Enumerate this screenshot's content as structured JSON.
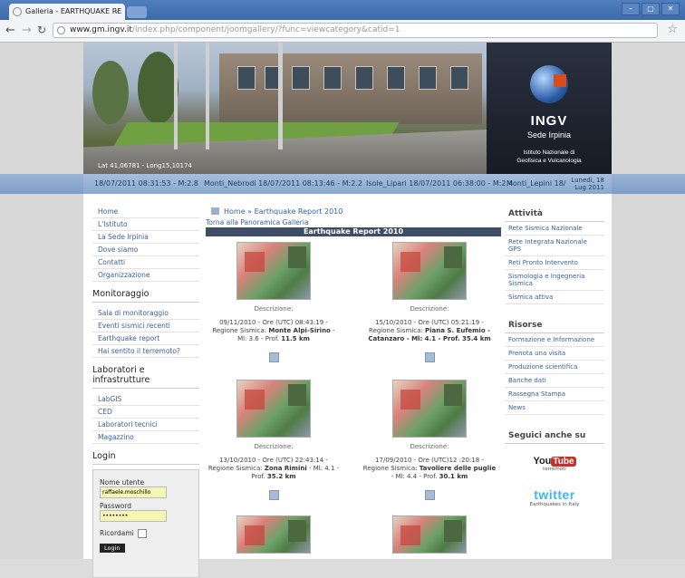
{
  "browser": {
    "tab_title": "Galleria - EARTHQUAKE RE",
    "tab_close": "×",
    "window_controls": [
      "–",
      "▢",
      "✕"
    ],
    "url_host": "www.gm.ingv.it",
    "url_path": "/index.php/component/joomgallery/?func=viewcategory&catid=1"
  },
  "header": {
    "coords": "Lat 41,06781 - Long15,10174",
    "brand": "INGV",
    "brand_sub": "Sede Irpinia",
    "institute_line1": "Istituto Nazionale di",
    "institute_line2": "Geofisica e Vulcanologia"
  },
  "ticker": {
    "items": [
      "18/07/2011 08:31:53 - M:2.8",
      "Monti_Nebrodi 18/07/2011 08:13:46 - M:2.2",
      "Isole_Lipari 18/07/2011 06:38:00 - M:2.4",
      "Monti_Lepini 18/"
    ],
    "date_line1": "Lunedì, 18",
    "date_line2": "Lug 2011"
  },
  "left_menu": {
    "main": [
      "Home",
      "L'Istituto",
      "La Sede Irpinia",
      "Dove siamo",
      "Contatti",
      "Organizzazione"
    ],
    "monitoring_title": "Monitoraggio",
    "monitoring": [
      "Sala di monitoraggio",
      "Eventi sismici recenti",
      "Earthquake report",
      "Hai sentito il terremoto?"
    ],
    "labs_title": "Laboratori e infrastrutture",
    "labs": [
      "LabGIS",
      "CED",
      "Laboratori tecnici",
      "Magazzino"
    ],
    "login_title": "Login",
    "username_label": "Nome utente",
    "username_value": "raffaele.moschillo",
    "password_label": "Password",
    "password_value": "........",
    "remember_label": "Ricordami",
    "login_button": "Login"
  },
  "content": {
    "breadcrumb": "Home » Earthquake Report 2010",
    "back_link": "Torna alla Panoramica Galleria",
    "category_title": "Earthquake Report 2010",
    "items": [
      {
        "desc": "Descrizione:",
        "line1": "09/11/2010 - Ore (UTC) 08:43:19 -",
        "line2_pre": "Regione Sismica: ",
        "line2_bold": "Monte Alpi-Sirino",
        "line2_post": " -",
        "line3_pre": "Ml: 3.6 - Prof. ",
        "line3_bold": "11.5 km"
      },
      {
        "desc": "Descrizione:",
        "line1": "15/10/2010 - Ore (UTC) 05:21:19 -",
        "line2_pre": "Regione Sismica: ",
        "line2_bold": "Piana S. Eufemio -",
        "line2_post": "",
        "line3_pre": "",
        "line3_bold": "Catanzaro - Ml: 4.1 - Prof. 35.4 km"
      },
      {
        "desc": "Descrizione:",
        "line1": "13/10/2010 - Ore (UTC) 22:43:14 -",
        "line2_pre": "Regione Sismica: ",
        "line2_bold": "Zona Rimini",
        "line2_post": " - Ml: 4.1 -",
        "line3_pre": "Prof. ",
        "line3_bold": "35.2 km"
      },
      {
        "desc": "Descrizione:",
        "line1": "17/09/2010 - Ore (UTC)12 :20:18 -",
        "line2_pre": "Regione Sismica: ",
        "line2_bold": "Tavoliere delle puglie",
        "line2_post": "",
        "line3_pre": "- Ml: 4.4 - Prof. ",
        "line3_bold": "30.1 km"
      }
    ]
  },
  "right_menu": {
    "activity_title": "Attività",
    "activity": [
      "Rete Sismica Nazionale",
      "Rete Integrata Nazionale GPS",
      "Reti Pronto Intervento",
      "Sismologia e Ingegneria Sismica",
      "Sismica attiva"
    ],
    "resources_title": "Risorse",
    "resources": [
      "Formazione e Informazione",
      "Prenota una visita",
      "Produzione scientifica",
      "Banche dati",
      "Rassegna Stampa",
      "News"
    ],
    "follow_title": "Seguici anche su",
    "youtube_you": "You",
    "youtube_tube": "Tube",
    "youtube_sub": "terremoti",
    "twitter": "twitter",
    "twitter_sub": "Earthquakes in Italy"
  }
}
